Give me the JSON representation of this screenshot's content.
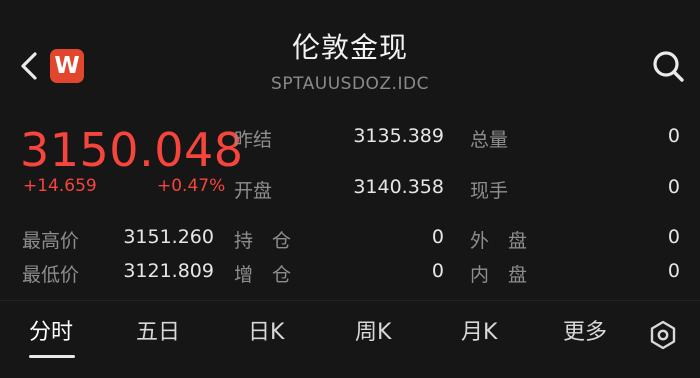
{
  "header": {
    "title": "伦敦金现",
    "code": "SPTAUUSDOZ.IDC",
    "brand_letter": "W"
  },
  "quote": {
    "price": "3150.048",
    "change": "+14.659",
    "change_pct": "+0.47%"
  },
  "stats": {
    "prev_close_label": "昨结",
    "prev_close_value": "3135.389",
    "open_label": "开盘",
    "open_value": "3140.358",
    "total_volume_label": "总量",
    "total_volume_value": "0",
    "current_hand_label": "现手",
    "current_hand_value": "0",
    "high_label": "最高价",
    "high_value": "3151.260",
    "low_label": "最低价",
    "low_value": "3121.809",
    "open_interest_label": "持　仓",
    "open_interest_value": "0",
    "oi_change_label": "增　仓",
    "oi_change_value": "0",
    "outer_label": "外　盘",
    "outer_value": "0",
    "inner_label": "内　盘",
    "inner_value": "0"
  },
  "tabs": [
    {
      "label": "分时"
    },
    {
      "label": "五日"
    },
    {
      "label": "日K"
    },
    {
      "label": "周K"
    },
    {
      "label": "月K"
    },
    {
      "label": "更多"
    }
  ],
  "colors": {
    "up": "#f5453c",
    "brand": "#e2472e",
    "background": "#161616"
  },
  "icons": [
    "back-arrow-icon",
    "brand-logo-icon",
    "search-icon",
    "settings-icon"
  ]
}
